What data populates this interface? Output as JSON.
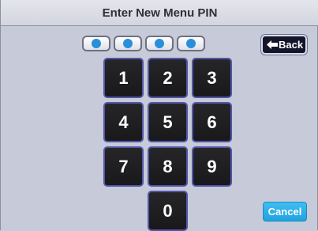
{
  "title": "Enter New Menu PIN",
  "pin": {
    "slots": 4,
    "filled": 4
  },
  "back": {
    "label": "Back",
    "icon": "left-arrow-icon"
  },
  "keypad": {
    "keys": [
      "1",
      "2",
      "3",
      "4",
      "5",
      "6",
      "7",
      "8",
      "9",
      "0"
    ]
  },
  "cancel": {
    "label": "Cancel"
  },
  "colors": {
    "background": "#c7cad8",
    "key_fill": "#1f1f21",
    "key_border": "#5255a8",
    "pin_dot": "#2a8fd8",
    "cancel_fill": "#2fb2ea",
    "back_fill": "#15152a"
  }
}
